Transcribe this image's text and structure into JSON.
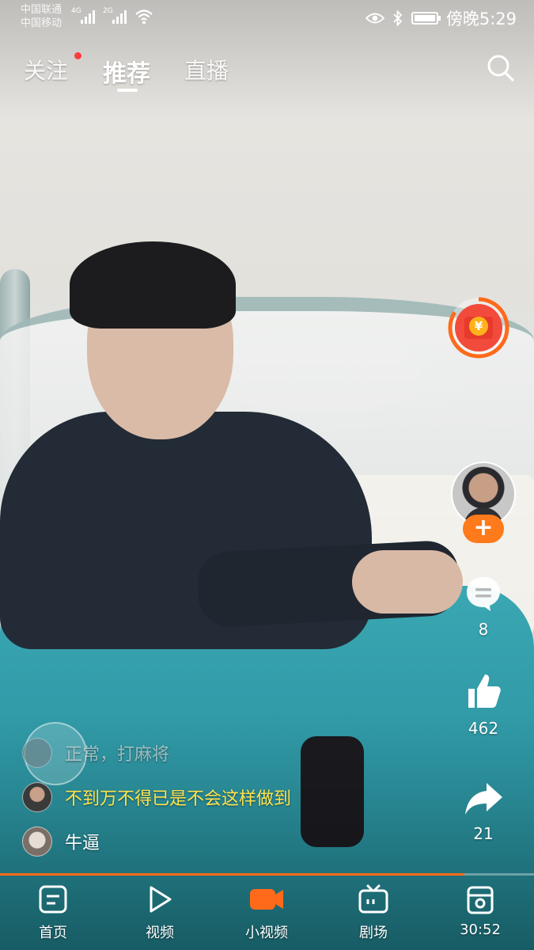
{
  "status_bar": {
    "carrier_1": "中国联通",
    "carrier_2": "中国移动",
    "network_1": "4G",
    "network_2": "2G",
    "time": "傍晚5:29",
    "icons": [
      "eye-icon",
      "bluetooth-icon",
      "battery-icon"
    ]
  },
  "top_tabs": {
    "follow": "关注",
    "recommend": "推荐",
    "live": "直播",
    "active": "推荐"
  },
  "rail": {
    "comment_count": "8",
    "like_count": "462",
    "share_count": "21",
    "follow_symbol": "+",
    "redpacket_symbol": "¥"
  },
  "comments": [
    {
      "text": "正常，打麻将",
      "style": "faded"
    },
    {
      "text": "不到万不得已是不会这样做到",
      "style": "yellow"
    },
    {
      "text": "牛逼",
      "style": "white"
    }
  ],
  "progress": {
    "fraction": 0.87,
    "color": "#ff6a1a"
  },
  "bottom_nav": {
    "home": "首页",
    "video": "视频",
    "short_video": "小视频",
    "theater": "剧场",
    "timer": "30:52",
    "active": "小视频"
  },
  "colors": {
    "accent": "#ff7a1a",
    "comment_highlight": "#ffe34d",
    "red_dot": "#ff3b3b"
  }
}
